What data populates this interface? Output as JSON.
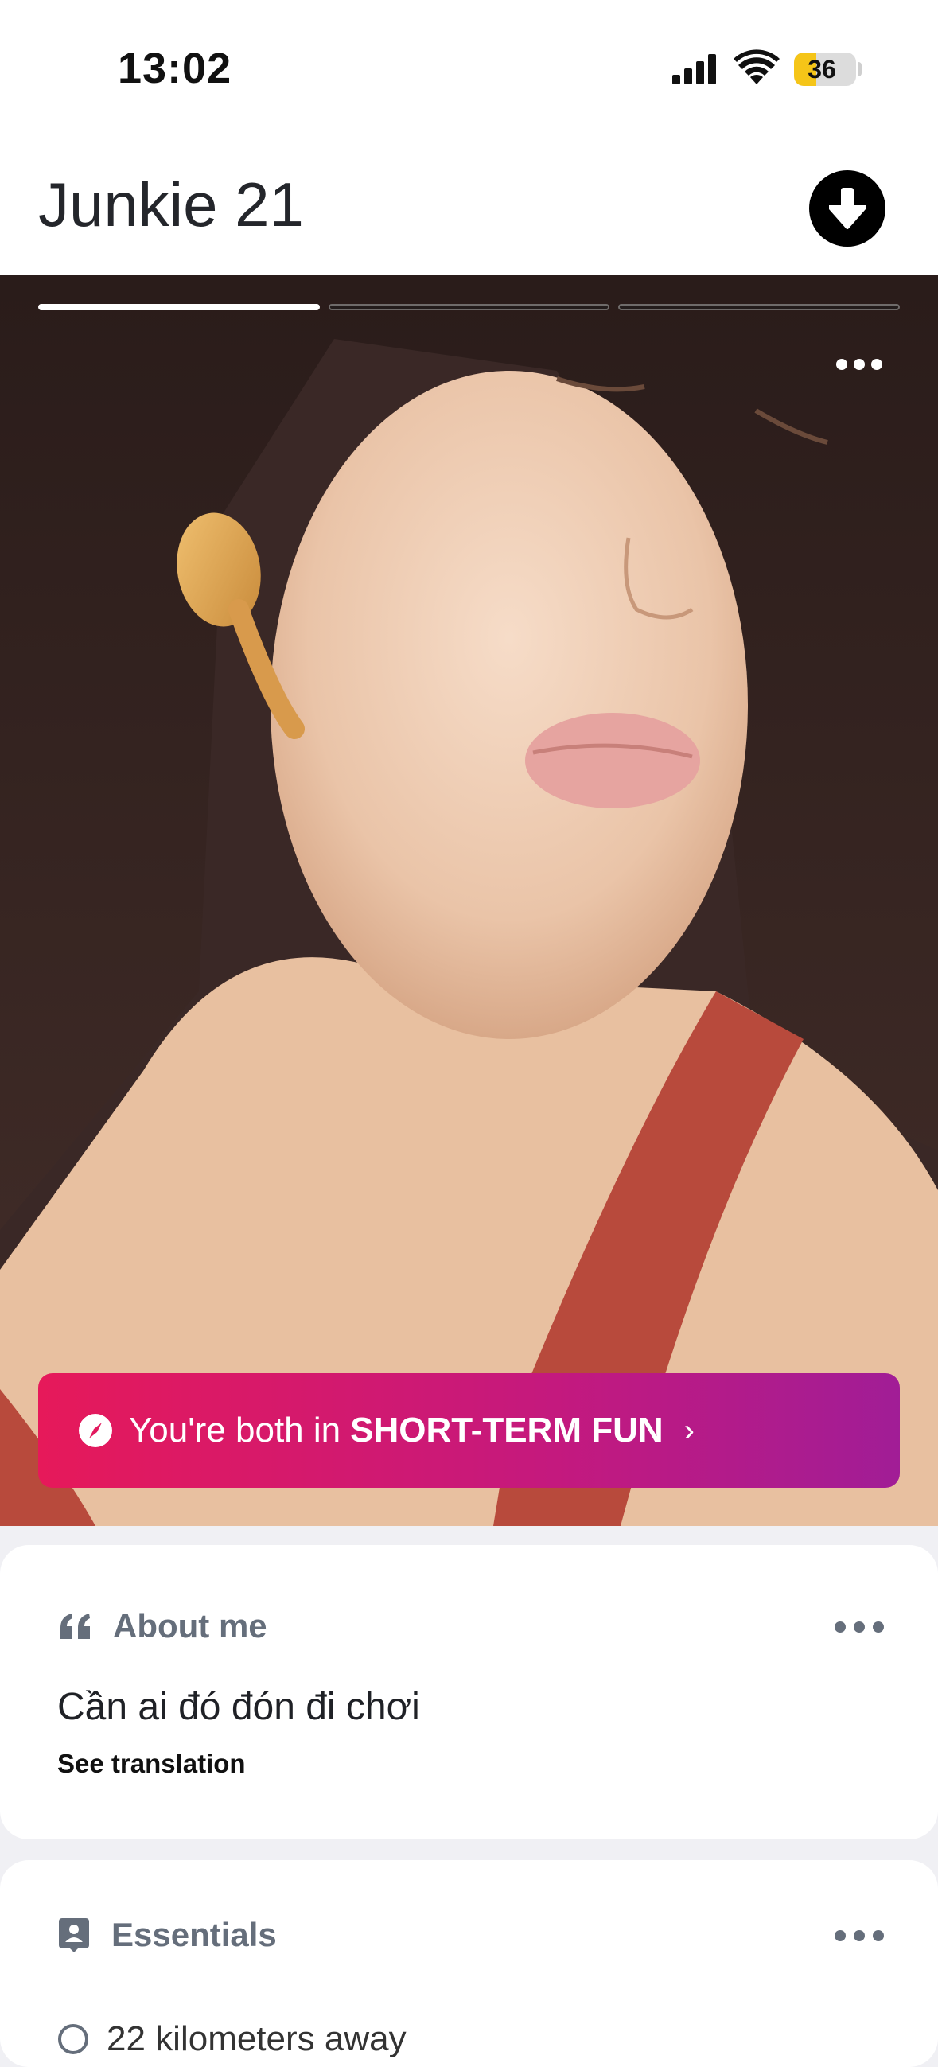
{
  "status_bar": {
    "time": "13:02",
    "battery_level": "36",
    "battery_fraction": 0.36
  },
  "header": {
    "name_age": "Junkie 21"
  },
  "photo": {
    "photo_index": 1,
    "photo_count": 3
  },
  "intent": {
    "prefix": "You're both in",
    "value": "SHORT-TERM FUN"
  },
  "about": {
    "title": "About me",
    "text": "Cần ai đó đón đi chơi",
    "translate_label": "See translation"
  },
  "essentials": {
    "title": "Essentials",
    "first_item_partial": "22 kilometers away"
  },
  "colors": {
    "intent_gradient_start": "#e6195a",
    "intent_gradient_end": "#a11d96",
    "section_title": "#656e7b"
  }
}
